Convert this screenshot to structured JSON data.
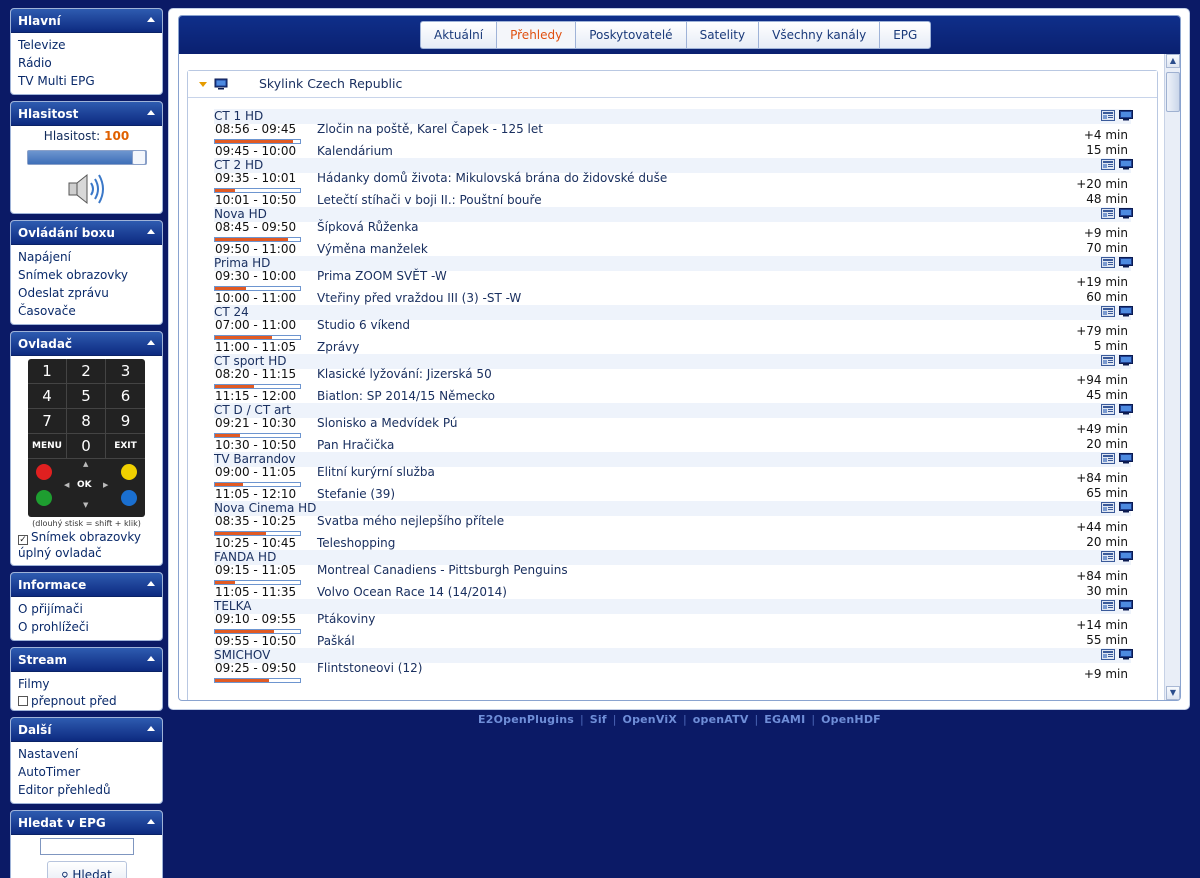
{
  "sidebar": {
    "main": {
      "title": "Hlavní",
      "items": [
        "Televize",
        "Rádio",
        "TV Multi EPG"
      ]
    },
    "volume": {
      "title": "Hlasitost",
      "label": "Hlasitost:",
      "value": "100",
      "level_percent": 100
    },
    "box_control": {
      "title": "Ovládání boxu",
      "items": [
        "Napájení",
        "Snímek obrazovky",
        "Odeslat zprávu",
        "Časovače"
      ]
    },
    "remote": {
      "title": "Ovladač",
      "keys": [
        "1",
        "2",
        "3",
        "4",
        "5",
        "6",
        "7",
        "8",
        "9",
        "MENU",
        "0",
        "EXIT"
      ],
      "ok_label": "OK",
      "note": "(dlouhý stisk = shift + klik)",
      "screenshot_check_label": "Snímek obrazovky",
      "full_remote_label": "úplný ovladač",
      "colors": {
        "red": "#e02020",
        "green": "#1e9e30",
        "yellow": "#f0d000",
        "blue": "#1a6fd0"
      }
    },
    "info": {
      "title": "Informace",
      "items": [
        "O přijímači",
        "O prohlížeči"
      ]
    },
    "stream": {
      "title": "Stream",
      "items": [
        "Filmy"
      ],
      "switch_label": "přepnout před"
    },
    "more": {
      "title": "Další",
      "items": [
        "Nastavení",
        "AutoTimer",
        "Editor přehledů"
      ]
    },
    "search": {
      "title": "Hledat v EPG",
      "button_label": "Hledat",
      "input_value": ""
    }
  },
  "tabs": [
    "Aktuální",
    "Přehledy",
    "Poskytovatelé",
    "Satelity",
    "Všechny kanály",
    "EPG"
  ],
  "active_tab": "Přehledy",
  "bouquet": {
    "title": "Skylink Czech Republic"
  },
  "channels": [
    {
      "name": "CT 1 HD",
      "now": {
        "time": "08:56 - 09:45",
        "title": "Zločin na poště, Karel Čapek - 125 let",
        "remaining": "+4 min",
        "progress": 0.92
      },
      "next": {
        "time": "09:45 - 10:00",
        "title": "Kalendárium",
        "duration": "15 min"
      }
    },
    {
      "name": "CT 2 HD",
      "now": {
        "time": "09:35 - 10:01",
        "title": "Hádanky domů života: Mikulovská brána do židovské duše",
        "remaining": "+20 min",
        "progress": 0.23
      },
      "next": {
        "time": "10:01 - 10:50",
        "title": "Letečtí stíhači v boji II.: Pouštní bouře",
        "duration": "48 min"
      }
    },
    {
      "name": "Nova HD",
      "now": {
        "time": "08:45 - 09:50",
        "title": "Šípková Růženka",
        "remaining": "+9 min",
        "progress": 0.86
      },
      "next": {
        "time": "09:50 - 11:00",
        "title": "Výměna manželek",
        "duration": "70 min"
      }
    },
    {
      "name": "Prima HD",
      "now": {
        "time": "09:30 - 10:00",
        "title": "Prima ZOOM SVĚT -W",
        "remaining": "+19 min",
        "progress": 0.37
      },
      "next": {
        "time": "10:00 - 11:00",
        "title": "Vteřiny před vraždou III (3) -ST -W",
        "duration": "60 min"
      }
    },
    {
      "name": "CT 24",
      "now": {
        "time": "07:00 - 11:00",
        "title": "Studio 6 víkend",
        "remaining": "+79 min",
        "progress": 0.67
      },
      "next": {
        "time": "11:00 - 11:05",
        "title": "Zprávy",
        "duration": "5 min"
      }
    },
    {
      "name": "CT sport HD",
      "now": {
        "time": "08:20 - 11:15",
        "title": "Klasické lyžování: Jizerská 50",
        "remaining": "+94 min",
        "progress": 0.46
      },
      "next": {
        "time": "11:15 - 12:00",
        "title": "Biatlon: SP 2014/15 Německo",
        "duration": "45 min"
      }
    },
    {
      "name": "CT D / CT art",
      "now": {
        "time": "09:21 - 10:30",
        "title": "Slonisko a Medvídek Pú",
        "remaining": "+49 min",
        "progress": 0.29
      },
      "next": {
        "time": "10:30 - 10:50",
        "title": "Pan Hračička",
        "duration": "20 min"
      }
    },
    {
      "name": "TV Barrandov",
      "now": {
        "time": "09:00 - 11:05",
        "title": "Elitní kurýrní služba",
        "remaining": "+84 min",
        "progress": 0.33
      },
      "next": {
        "time": "11:05 - 12:10",
        "title": "Stefanie (39)",
        "duration": "65 min"
      }
    },
    {
      "name": "Nova Cinema HD",
      "now": {
        "time": "08:35 - 10:25",
        "title": "Svatba mého nejlepšího přítele",
        "remaining": "+44 min",
        "progress": 0.6
      },
      "next": {
        "time": "10:25 - 10:45",
        "title": "Teleshopping",
        "duration": "20 min"
      }
    },
    {
      "name": "FANDA HD",
      "now": {
        "time": "09:15 - 11:05",
        "title": "Montreal Canadiens - Pittsburgh Penguins",
        "remaining": "+84 min",
        "progress": 0.24
      },
      "next": {
        "time": "11:05 - 11:35",
        "title": "Volvo Ocean Race 14 (14/2014)",
        "duration": "30 min"
      }
    },
    {
      "name": "TELKA",
      "now": {
        "time": "09:10 - 09:55",
        "title": "Ptákoviny",
        "remaining": "+14 min",
        "progress": 0.69
      },
      "next": {
        "time": "09:55 - 10:50",
        "title": "Paškál",
        "duration": "55 min"
      }
    },
    {
      "name": "SMICHOV",
      "now": {
        "time": "09:25 - 09:50",
        "title": "Flintstoneovi (12)",
        "remaining": "+9 min",
        "progress": 0.64
      },
      "next": null
    }
  ],
  "footer_links": [
    "E2OpenPlugins",
    "Sif",
    "OpenViX",
    "openATV",
    "EGAMI",
    "OpenHDF"
  ],
  "colors": {
    "background": "#0b1a66",
    "accent": "#e05010",
    "progress": "#e15a23",
    "panel_header": "#0d2a80"
  }
}
